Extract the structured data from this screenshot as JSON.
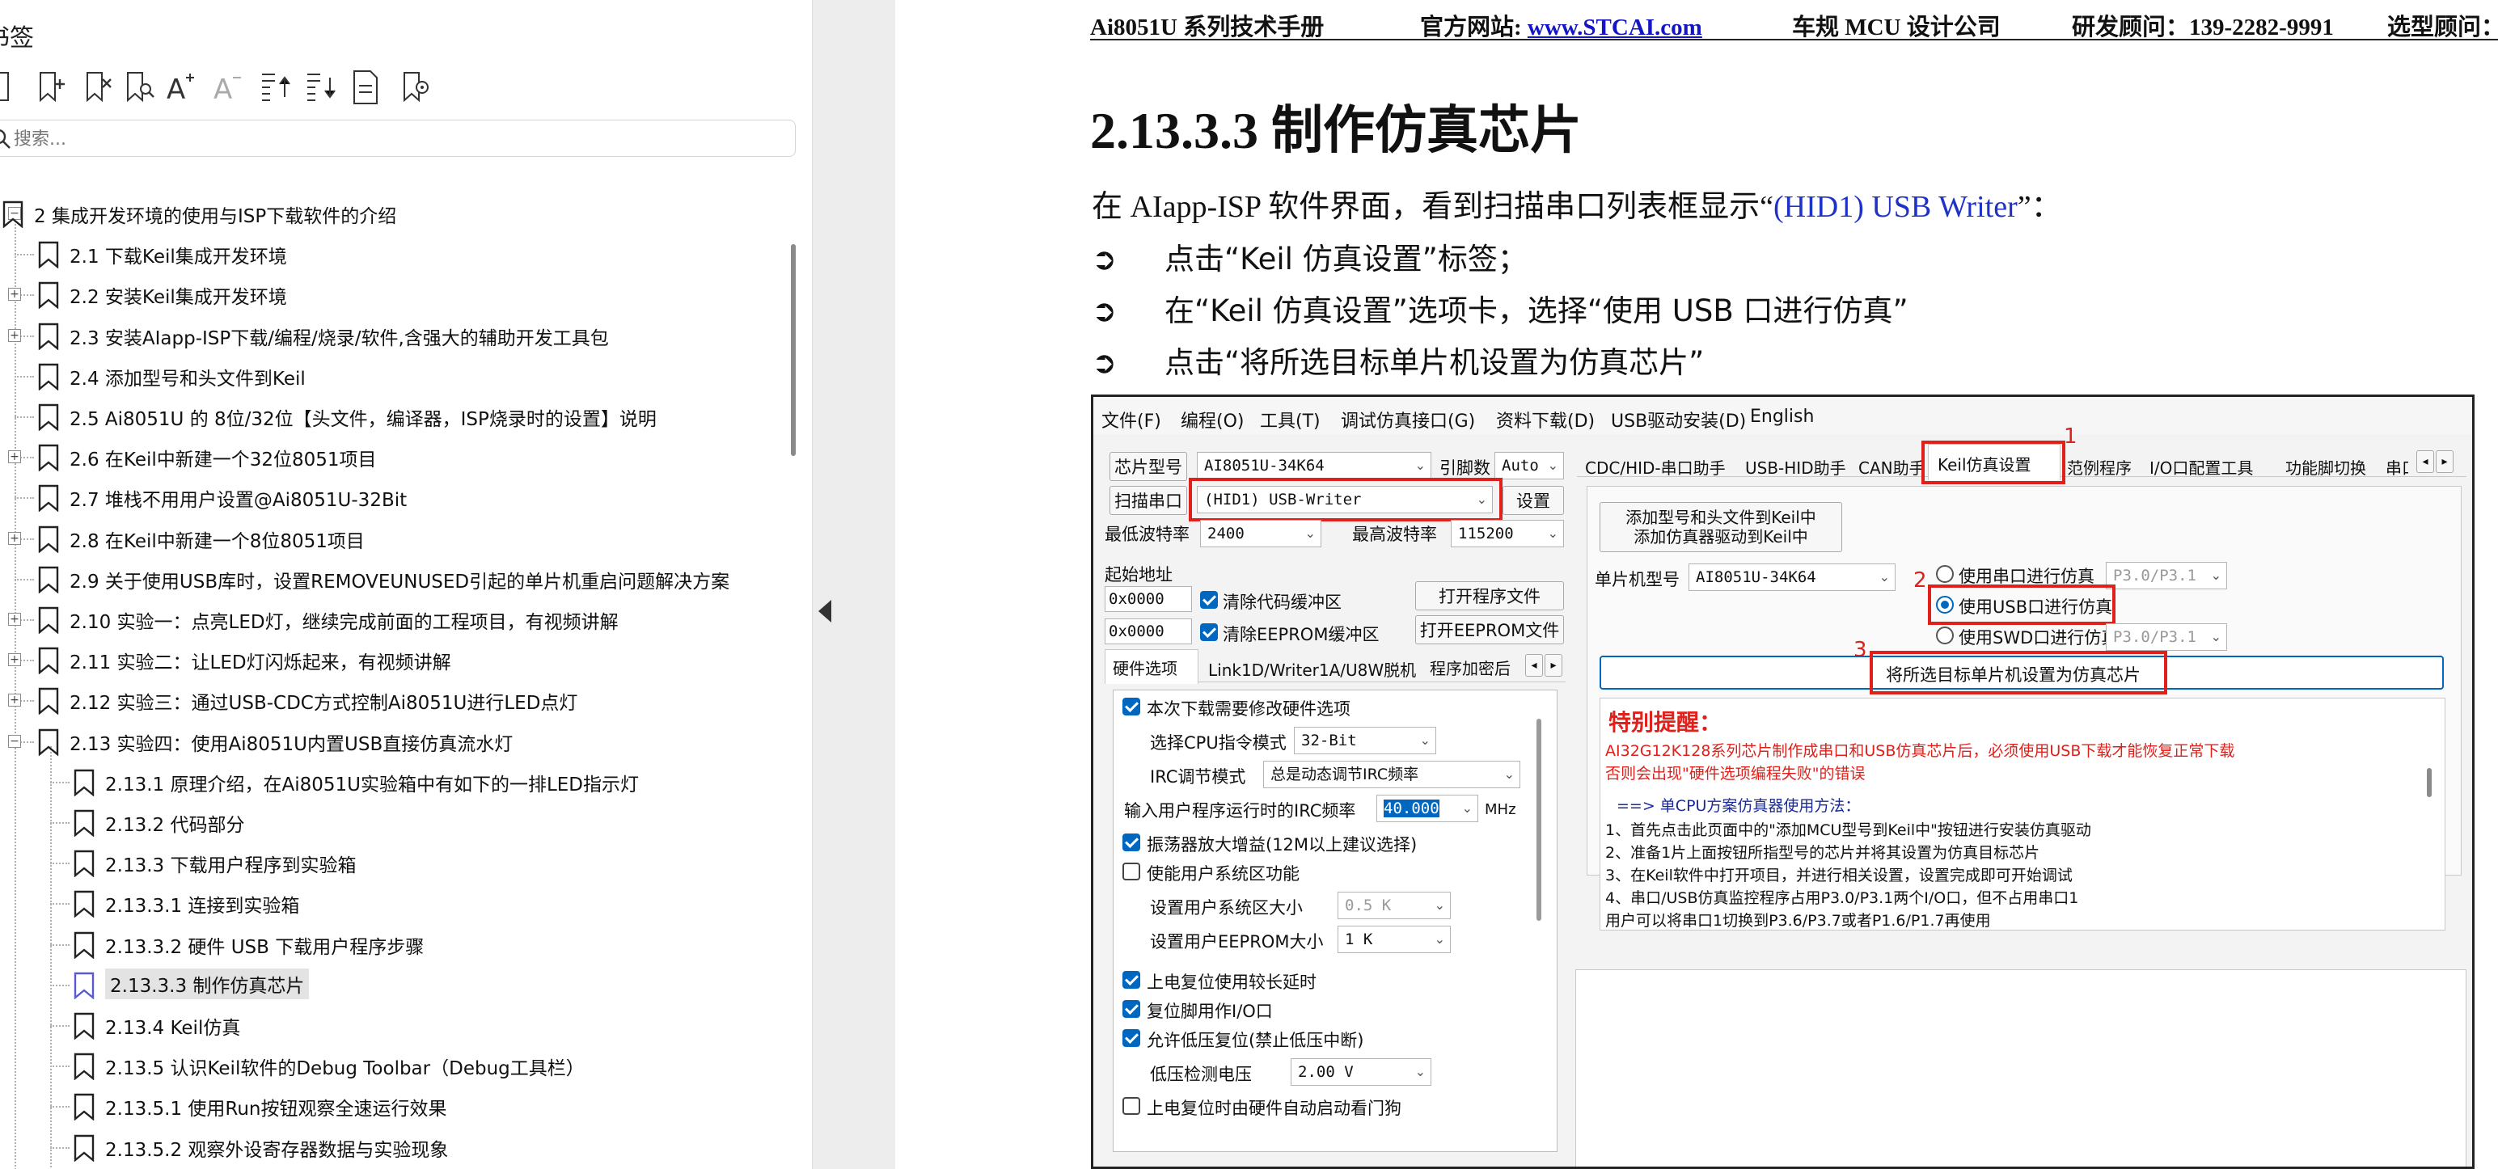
{
  "bookmarks": {
    "title": "书签",
    "search_placeholder": "搜索...",
    "toolbar_icons": [
      "expand-all-icon",
      "add-bookmark-icon",
      "delete-bookmark-icon",
      "find-bookmark-icon",
      "enlarge-text-icon",
      "reduce-text-icon",
      "expand-current-icon",
      "collapse-current-icon",
      "bookmark-properties-icon",
      "bookmark-options-icon",
      "new-bookmark-icon"
    ],
    "items": [
      {
        "label": "2  集成开发环境的使用与ISP下载软件的介绍",
        "level": 0,
        "expander": "minus"
      },
      {
        "label": "2.1 下载Keil集成开发环境",
        "level": 1,
        "expander": ""
      },
      {
        "label": "2.2  安装Keil集成开发环境",
        "level": 1,
        "expander": "plus"
      },
      {
        "label": "2.3  安装AIapp-ISP下载/编程/烧录/软件,含强大的辅助开发工具包",
        "level": 1,
        "expander": "plus"
      },
      {
        "label": "2.4  添加型号和头文件到Keil",
        "level": 1,
        "expander": ""
      },
      {
        "label": "2.5  Ai8051U 的 8位/32位【头文件，编译器，ISP烧录时的设置】说明",
        "level": 1,
        "expander": ""
      },
      {
        "label": "2.6 在Keil中新建一个32位8051项目",
        "level": 1,
        "expander": "plus"
      },
      {
        "label": "2.7 堆栈不用用户设置@Ai8051U-32Bit",
        "level": 1,
        "expander": ""
      },
      {
        "label": "2.8  在Keil中新建一个8位8051项目",
        "level": 1,
        "expander": "plus"
      },
      {
        "label": "2.9  关于使用USB库时，设置REMOVEUNUSED引起的单片机重启问题解决方案",
        "level": 1,
        "expander": ""
      },
      {
        "label": "2.10  实验一：点亮LED灯，继续完成前面的工程项目，有视频讲解",
        "level": 1,
        "expander": "plus"
      },
      {
        "label": "2.11  实验二：让LED灯闪烁起来，有视频讲解",
        "level": 1,
        "expander": "plus"
      },
      {
        "label": "2.12  实验三：通过USB-CDC方式控制Ai8051U进行LED点灯",
        "level": 1,
        "expander": "plus"
      },
      {
        "label": "2.13 实验四：使用Ai8051U内置USB直接仿真流水灯",
        "level": 1,
        "expander": "minus"
      },
      {
        "label": "2.13.1 原理介绍，在Ai8051U实验箱中有如下的一排LED指示灯",
        "level": 2,
        "expander": ""
      },
      {
        "label": "2.13.2 代码部分",
        "level": 2,
        "expander": ""
      },
      {
        "label": "2.13.3  下载用户程序到实验箱",
        "level": 2,
        "expander": ""
      },
      {
        "label": "2.13.3.1 连接到实验箱",
        "level": 2,
        "expander": ""
      },
      {
        "label": "2.13.3.2 硬件 USB 下载用户程序步骤",
        "level": 2,
        "expander": ""
      },
      {
        "label": "2.13.3.3  制作仿真芯片",
        "level": 2,
        "expander": "",
        "selected": true
      },
      {
        "label": "2.13.4  Keil仿真",
        "level": 2,
        "expander": ""
      },
      {
        "label": "2.13.5  认识Keil软件的Debug Toolbar（Debug工具栏）",
        "level": 2,
        "expander": ""
      },
      {
        "label": "2.13.5.1  使用Run按钮观察全速运行效果",
        "level": 2,
        "expander": ""
      },
      {
        "label": "2.13.5.2 观察外设寄存器数据与实验现象",
        "level": 2,
        "expander": ""
      }
    ]
  },
  "document": {
    "header": {
      "manual": "Ai8051U 系列技术手册",
      "site_label": "官方网站: ",
      "site_link": "www.STCAI.com",
      "company": "车规 MCU 设计公司",
      "consultant": "研发顾问：139-2282-9991",
      "selection": "选型顾问："
    },
    "heading": "2.13.3.3   制作仿真芯片",
    "intro_prefix": "在 AIapp-ISP 软件界面，看到扫描串口列表框显示“",
    "intro_highlight": "(HID1) USB Writer",
    "intro_suffix": "”：",
    "bullet_symbol": "➲",
    "bullets": [
      "点击“Keil 仿真设置”标签；",
      "在“Keil 仿真设置”选项卡，选择“使用 USB 口进行仿真”",
      "点击“将所选目标单片机设置为仿真芯片”"
    ]
  },
  "app": {
    "menu": [
      "文件(F)",
      "编程(O)",
      "工具(T)",
      "调试仿真接口(G)",
      "资料下载(D)",
      "USB驱动安装(D)",
      "English"
    ],
    "chip_model_label": "芯片型号",
    "chip_model_value": "AI8051U-34K64",
    "pin_count_label": "引脚数",
    "pin_count_value": "Auto",
    "scan_port_label": "扫描串口",
    "scan_port_value": "(HID1) USB-Writer",
    "settings_btn": "设置",
    "min_baud_label": "最低波特率",
    "min_baud_value": "2400",
    "max_baud_label": "最高波特率",
    "max_baud_value": "115200",
    "start_addr_label": "起始地址",
    "addr1": "0x0000",
    "clear_code_label": "清除代码缓冲区",
    "open_prog_btn": "打开程序文件",
    "addr2": "0x0000",
    "clear_eeprom_label": "清除EEPROM缓冲区",
    "open_eeprom_btn": "打开EEPROM文件",
    "left_tabs": [
      "硬件选项",
      "Link1D/Writer1A/U8W脱机",
      "程序加密后"
    ],
    "hw": {
      "modify_label": "本次下载需要修改硬件选项",
      "cpu_mode_label": "选择CPU指令模式",
      "cpu_mode_value": "32-Bit",
      "irc_mode_label": "IRC调节模式",
      "irc_mode_value": "总是动态调节IRC频率",
      "irc_freq_label": "输入用户程序运行时的IRC频率",
      "irc_freq_value": "40.000",
      "irc_unit": "MHz",
      "osc_gain_label": "振荡器放大增益(12M以上建议选择)",
      "sys_area_label": "使能用户系统区功能",
      "sys_area_size_label": "设置用户系统区大小",
      "sys_area_size_value": "0.5 K",
      "eeprom_size_label": "设置用户EEPROM大小",
      "eeprom_size_value": "1   K",
      "power_delay_label": "上电复位使用较长延时",
      "reset_io_label": "复位脚用作I/O口",
      "lvr_label": "允许低压复位(禁止低压中断)",
      "lvd_label": "低压检测电压",
      "lvd_value": "2.00 V",
      "wdt_label": "上电复位时由硬件自动启动看门狗"
    },
    "right_tabs": [
      "CDC/HID-串口助手",
      "USB-HID助手",
      "CAN助手",
      "Keil仿真设置",
      "范例程序",
      "I/O口配置工具",
      "功能脚切换",
      "串口"
    ],
    "keil": {
      "add_btn_line1": "添加型号和头文件到Keil中",
      "add_btn_line2": "添加仿真器驱动到Keil中",
      "mcu_model_label": "单片机型号",
      "mcu_model_value": "AI8051U-34K64",
      "radio_serial": "使用串口进行仿真",
      "radio_serial_port": "P3.0/P3.1",
      "radio_usb": "使用USB口进行仿真",
      "radio_swd": "使用SWD口进行仿真",
      "radio_swd_port": "P3.0/P3.1",
      "set_sim_btn": "将所选目标单片机设置为仿真芯片",
      "num1": "1",
      "num2": "2",
      "num3": "3"
    },
    "notice": {
      "title": "特别提醒：",
      "line1": "AI32G12K128系列芯片制作成串口和USB仿真芯片后，必须使用USB下载才能恢复正常下载",
      "line2": "否则会出现\"硬件选项编程失败\"的错误",
      "method_title": "==> 单CPU方案仿真器使用方法：",
      "steps": [
        "1、首先点击此页面中的\"添加MCU型号到Keil中\"按钮进行安装仿真驱动",
        "2、准备1片上面按钮所指型号的芯片并将其设置为仿真目标芯片",
        "3、在Keil软件中打开项目，并进行相关设置，设置完成即可开始调试",
        "4、串口/USB仿真监控程序占用P3.0/P3.1两个I/O口，但不占用串口1",
        "    用户可以将串口1切换到P3.6/P3.7或者P1.6/P1.7再使用"
      ]
    }
  },
  "colors": {
    "accent_blue": "#0067c0",
    "annotation_red": "#e0201a",
    "link_blue": "#1515c8"
  }
}
